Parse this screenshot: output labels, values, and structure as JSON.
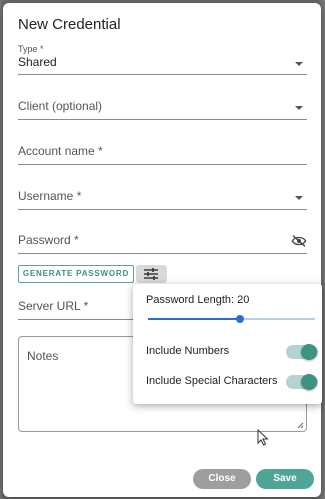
{
  "dialog": {
    "title": "New Credential",
    "type_label": "Type *",
    "type_value": "Shared",
    "client_label": "Client (optional)",
    "account_label": "Account name *",
    "username_label": "Username *",
    "password_label": "Password *",
    "generate_label": "GENERATE PASSWORD",
    "server_label": "Server URL *",
    "notes_label": "Notes",
    "close_label": "Close",
    "save_label": "Save"
  },
  "generator": {
    "length_label": "Password Length: 20",
    "length_value": 20,
    "length_fraction": 0.55,
    "include_numbers_label": "Include Numbers",
    "include_numbers_on": true,
    "include_special_label": "Include Special Characters",
    "include_special_on": true
  },
  "colors": {
    "accent": "#3e9183",
    "slider": "#2c6fcf",
    "close": "#9e9e9e",
    "save": "#4fa598"
  },
  "icons": {
    "visibility": "eye-off-icon",
    "options": "tune-icon",
    "dropdown": "chevron-down-icon",
    "cursor": "mouse-pointer-icon",
    "resize": "resize-handle-icon"
  }
}
